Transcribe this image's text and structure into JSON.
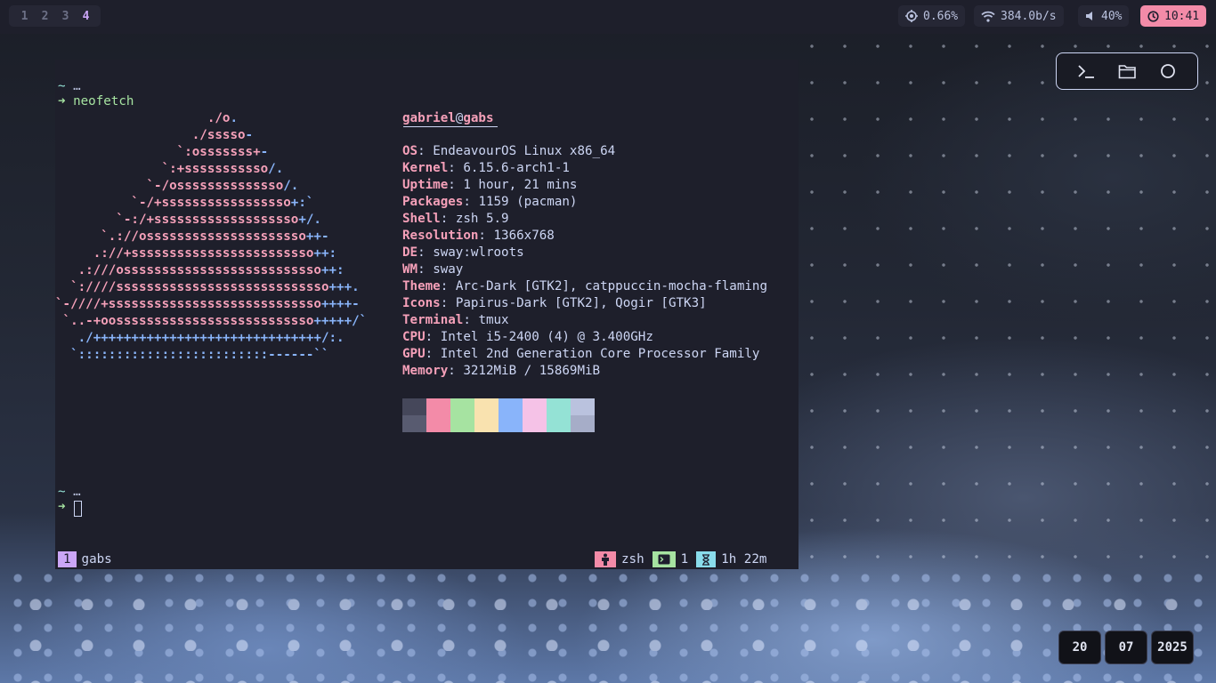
{
  "bar": {
    "workspaces": [
      "1",
      "2",
      "3",
      "4"
    ],
    "active_workspace": "4",
    "cpu": "0.66%",
    "network": "384.0b/s",
    "volume": "40%",
    "clock": "10:41",
    "icons": {
      "cpu": "cpu-icon",
      "network": "wifi-icon",
      "volume": "speaker-icon",
      "clock": "clock-icon"
    }
  },
  "terminal": {
    "prompt_dir": "~",
    "prompt_ellipsis": "…",
    "prompt_arrow": "➜",
    "command": "neofetch",
    "title_user": "gabriel",
    "title_at": "@",
    "title_host": "gabs",
    "info": [
      {
        "key": "OS",
        "value": "EndeavourOS Linux x86_64"
      },
      {
        "key": "Kernel",
        "value": "6.15.6-arch1-1"
      },
      {
        "key": "Uptime",
        "value": "1 hour, 21 mins"
      },
      {
        "key": "Packages",
        "value": "1159 (pacman)"
      },
      {
        "key": "Shell",
        "value": "zsh 5.9"
      },
      {
        "key": "Resolution",
        "value": "1366x768"
      },
      {
        "key": "DE",
        "value": "sway:wlroots"
      },
      {
        "key": "WM",
        "value": "sway"
      },
      {
        "key": "Theme",
        "value": "Arc-Dark [GTK2], catppuccin-mocha-flaming"
      },
      {
        "key": "Icons",
        "value": "Papirus-Dark [GTK2], Qogir [GTK3]"
      },
      {
        "key": "Terminal",
        "value": "tmux"
      },
      {
        "key": "CPU",
        "value": "Intel i5-2400 (4) @ 3.400GHz"
      },
      {
        "key": "GPU",
        "value": "Intel 2nd Generation Core Processor Family"
      },
      {
        "key": "Memory",
        "value": "3212MiB / 15869MiB"
      }
    ],
    "ascii_art": [
      [
        [
          "p",
          "                    ./o"
        ],
        [
          "b",
          "."
        ]
      ],
      [
        [
          "p",
          "                  ./sssso"
        ],
        [
          "b",
          "-"
        ]
      ],
      [
        [
          "p",
          "                `:osssssss+"
        ],
        [
          "b",
          "-"
        ]
      ],
      [
        [
          "p",
          "              `:+sssssssssso"
        ],
        [
          "b",
          "/."
        ]
      ],
      [
        [
          "p",
          "            `-/ossssssssssssso"
        ],
        [
          "b",
          "/."
        ]
      ],
      [
        [
          "p",
          "          `-/+sssssssssssssssso"
        ],
        [
          "b",
          "+:`"
        ]
      ],
      [
        [
          "p",
          "        `-:/+sssssssssssssssssso"
        ],
        [
          "b",
          "+/."
        ]
      ],
      [
        [
          "p",
          "      `.://osssssssssssssssssssso"
        ],
        [
          "b",
          "++-"
        ]
      ],
      [
        [
          "p",
          "     .://+ssssssssssssssssssssssso"
        ],
        [
          "b",
          "++:"
        ]
      ],
      [
        [
          "p",
          "   .:///ossssssssssssssssssssssssso"
        ],
        [
          "b",
          "++:"
        ]
      ],
      [
        [
          "p",
          "  `:////ssssssssssssssssssssssssssso"
        ],
        [
          "b",
          "+++."
        ]
      ],
      [
        [
          "p",
          "`-////+ssssssssssssssssssssssssssso"
        ],
        [
          "b",
          "++++-"
        ]
      ],
      [
        [
          "p",
          " `..-+oossssssssssssssssssssssssso"
        ],
        [
          "b",
          "+++++/`"
        ]
      ],
      [
        [
          "b",
          "   ./++++++++++++++++++++++++++++++/:."
        ]
      ],
      [
        [
          "b",
          "  `:::::::::::::::::::::::::------``"
        ]
      ]
    ],
    "palette_top": [
      "#45475a",
      "#f38ba8",
      "#a6e3a1",
      "#f9e2af",
      "#89b4fa",
      "#f5c2e7",
      "#94e2d5",
      "#bac2de"
    ],
    "palette_bottom": [
      "#585b70",
      "#f38ba8",
      "#a6e3a1",
      "#f9e2af",
      "#89b4fa",
      "#f5c2e7",
      "#94e2d5",
      "#a6adc8"
    ]
  },
  "tmux": {
    "window_index": "1",
    "session_name": "gabs",
    "shell": "zsh",
    "panes": "1",
    "uptime": "1h 22m",
    "colors": {
      "window": "#cba6f7",
      "shell": "#f38ba8",
      "panes": "#a6e3a1",
      "uptime": "#89dceb"
    }
  },
  "dock": {
    "icons": [
      "terminal-icon",
      "folder-icon",
      "circle-icon"
    ]
  },
  "date": {
    "day": "20",
    "month": "07",
    "year": "2025"
  }
}
